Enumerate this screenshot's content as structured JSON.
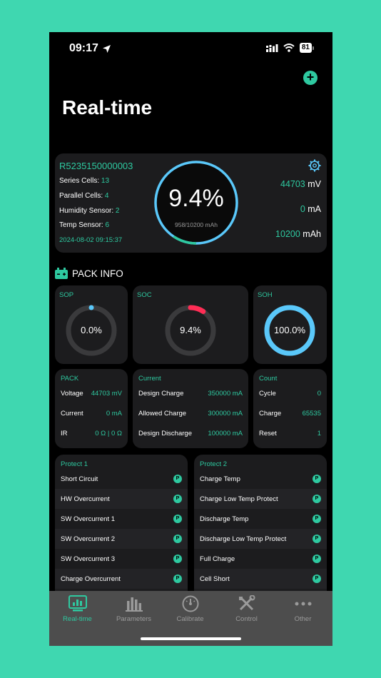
{
  "status": {
    "time": "09:17",
    "battery": "81"
  },
  "header": {
    "title": "Real-time"
  },
  "device": {
    "id": "R5235150000003",
    "rows": [
      {
        "label": "Series Cells: ",
        "value": "13"
      },
      {
        "label": "Parallel Cells: ",
        "value": "4"
      },
      {
        "label": "Humidity Sensor: ",
        "value": "2"
      },
      {
        "label": "Temp Sensor: ",
        "value": "6"
      }
    ],
    "date": "2024-08-02 09:15:37",
    "gauge": {
      "percent_text": "9.4%",
      "percent": 9.4,
      "sub": "958/10200 mAh"
    },
    "values": [
      {
        "num": "44703",
        "unit": " mV"
      },
      {
        "num": "0",
        "unit": " mA"
      },
      {
        "num": "10200",
        "unit": " mAh"
      }
    ]
  },
  "pack": {
    "title": "PACK INFO",
    "gauges": [
      {
        "title": "SOP",
        "value": "0.0%",
        "percent": 0,
        "color": "#5ac8fa"
      },
      {
        "title": "SOC",
        "value": "9.4%",
        "percent": 9.4,
        "color": "#ff2d55"
      },
      {
        "title": "SOH",
        "value": "100.0%",
        "percent": 100,
        "color": "#5ac8fa"
      }
    ]
  },
  "packcard": {
    "title": "PACK",
    "rows": [
      {
        "label": "Voltage",
        "value": "44703 mV"
      },
      {
        "label": "Current",
        "value": "0 mA"
      },
      {
        "label": "IR",
        "value": "0 Ω | 0 Ω"
      }
    ]
  },
  "currentcard": {
    "title": "Current",
    "rows": [
      {
        "label": "Design Charge",
        "value": "350000 mA"
      },
      {
        "label": "Allowed Charge",
        "value": "300000 mA"
      },
      {
        "label": "Design Discharge",
        "value": "100000 mA"
      }
    ]
  },
  "countcard": {
    "title": "Count",
    "rows": [
      {
        "label": "Cycle",
        "value": "0"
      },
      {
        "label": "Charge",
        "value": "65535"
      },
      {
        "label": "Reset",
        "value": "1"
      }
    ]
  },
  "protect1": {
    "title": "Protect 1",
    "badge": "P",
    "items": [
      "Short Circuit",
      "HW Overcurrent",
      "SW Overcurrent 1",
      "SW Overcurrent 2",
      "SW Overcurrent 3",
      "Charge Overcurrent"
    ]
  },
  "protect2": {
    "title": "Protect 2",
    "badge": "P",
    "items": [
      "Charge Temp",
      "Charge Low Temp Protect",
      "Discharge Temp",
      "Discharge Low Temp Protect",
      "Full Charge",
      "Cell Short"
    ]
  },
  "tabs": [
    "Real-time",
    "Parameters",
    "Calibrate",
    "Control",
    "Other"
  ],
  "colors": {
    "accent": "#2ec9a0",
    "blue": "#5ac8fa",
    "red": "#ff2d55"
  }
}
